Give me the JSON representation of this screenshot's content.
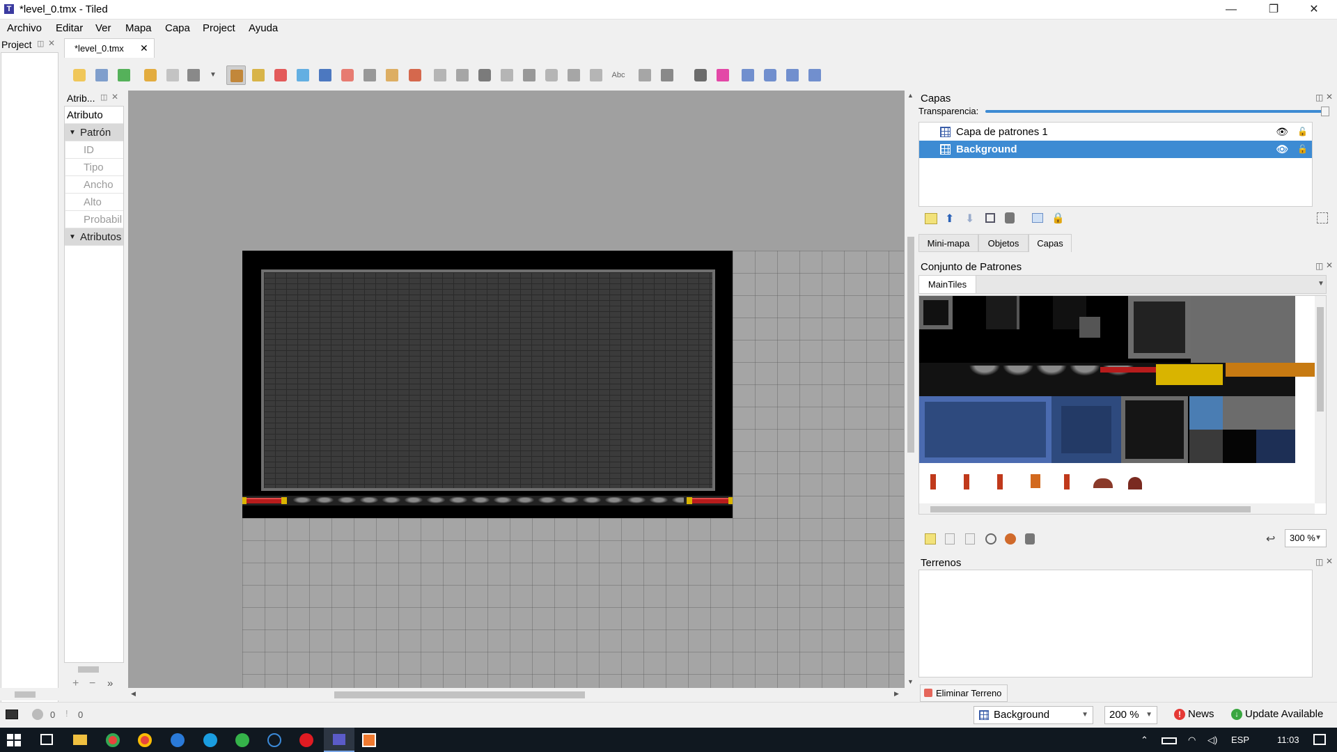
{
  "window": {
    "title": "*level_0.tmx - Tiled",
    "minimize": "—",
    "restore": "❐",
    "close": "✕"
  },
  "menu": [
    "Archivo",
    "Editar",
    "Ver",
    "Mapa",
    "Capa",
    "Project",
    "Ayuda"
  ],
  "project_dock": {
    "title": "Project"
  },
  "document_tab": {
    "label": "*level_0.tmx",
    "close": "✕"
  },
  "toolbar": {
    "icons": [
      "new-map-icon",
      "open-icon",
      "save-icon",
      "undo-icon",
      "redo-icon",
      "command-icon",
      "dropdown-arrow-icon",
      "stamp-brush-icon",
      "terrain-brush-icon",
      "wang-brush-icon",
      "bucket-fill-icon",
      "shape-fill-icon",
      "eraser-icon",
      "rect-select-icon",
      "magic-wand-icon",
      "select-same-tile-icon",
      "select-objects-icon",
      "edit-polygons-icon",
      "insert-rectangle-icon",
      "insert-point-icon",
      "insert-ellipse-icon",
      "insert-polygon-icon",
      "insert-tile-icon",
      "insert-template-icon",
      "insert-text-icon",
      "random-mode-icon",
      "wang-fill-icon",
      "stamp-random-icon",
      "color-icon",
      "flip-horizontal-icon",
      "flip-vertical-icon",
      "rotate-left-icon",
      "rotate-right-icon"
    ],
    "text_icon": "Abc"
  },
  "properties": {
    "title": "Atrib...",
    "column": "Atributo",
    "groups": [
      {
        "label": "Patrón",
        "items": [
          "ID",
          "Tipo",
          "Ancho",
          "Alto",
          "Probabil"
        ]
      },
      {
        "label": "Atributos",
        "items": []
      }
    ],
    "add": "+",
    "remove": "−",
    "more": "»"
  },
  "layers_panel": {
    "title": "Capas",
    "opacity_label": "Transparencia:",
    "opacity": 1.0,
    "layers": [
      {
        "name": "Capa de patrones 1",
        "visible": true,
        "selected": false
      },
      {
        "name": "Background",
        "visible": true,
        "selected": true
      }
    ]
  },
  "panel_tabs": [
    "Mini-mapa",
    "Objetos",
    "Capas"
  ],
  "active_panel_tab": "Capas",
  "tileset_panel": {
    "title": "Conjunto de Patrones",
    "tileset_tab": "MainTiles",
    "zoom": "300 %"
  },
  "terrain_panel": {
    "title": "Terrenos",
    "erase_button": "Eliminar Terreno"
  },
  "statusbar": {
    "error_count": "0",
    "warning_count": "0",
    "layer_combo": "Background",
    "zoom_combo": "200 %",
    "news": "News",
    "update": "Update Available"
  },
  "taskbar": {
    "language": "ESP",
    "time": "11:03"
  },
  "colors": {
    "selection": "#3d8bd3",
    "canvas": "#a0a0a0",
    "taskbar": "#101820"
  }
}
